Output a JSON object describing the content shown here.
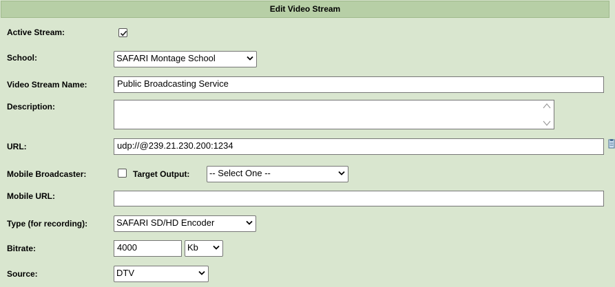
{
  "header": {
    "title": "Edit Video Stream"
  },
  "labels": {
    "active_stream": "Active Stream:",
    "school": "School:",
    "video_stream_name": "Video Stream Name:",
    "description": "Description:",
    "url": "URL:",
    "mobile_broadcaster": "Mobile Broadcaster:",
    "target_output": "Target Output:",
    "mobile_url": "Mobile URL:",
    "type_recording": "Type (for recording):",
    "bitrate": "Bitrate:",
    "source": "Source:"
  },
  "fields": {
    "active_stream_checked": true,
    "school_selected": "SAFARI Montage School",
    "video_stream_name_value": "Public Broadcasting Service",
    "description_value": "",
    "url_value": "udp://@239.21.230.200:1234",
    "mobile_broadcaster_checked": false,
    "target_output_selected": "-- Select One --",
    "mobile_url_value": "",
    "type_selected": "SAFARI SD/HD Encoder",
    "bitrate_value": "4000",
    "bitrate_unit_selected": "Kb",
    "source_selected": "DTV"
  },
  "icons": {
    "caret": "chevron-down-icon",
    "check": "check-icon",
    "url_side": "clipboard-icon"
  },
  "colors": {
    "panel_bg": "#d9e6cf",
    "header_bg": "#b7cfa6"
  }
}
